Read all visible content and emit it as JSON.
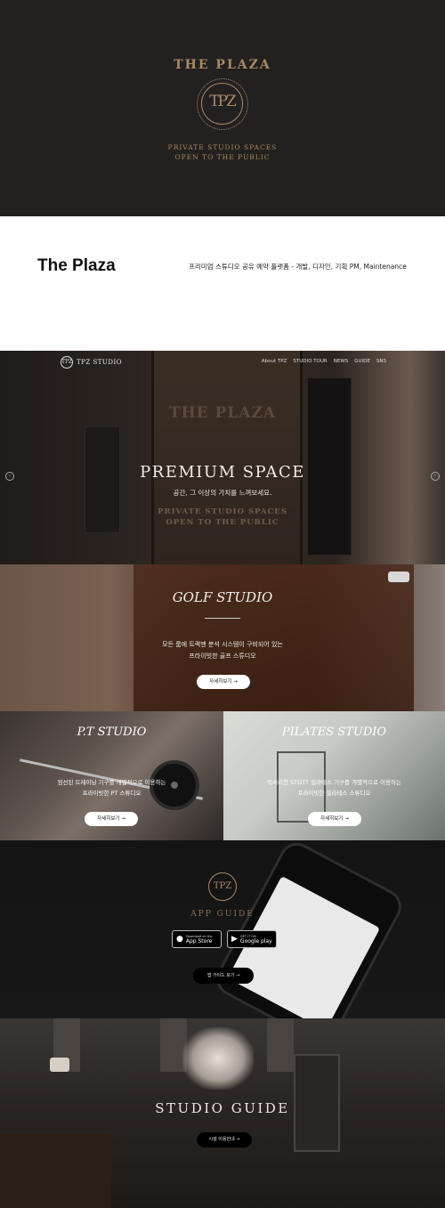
{
  "hero": {
    "title": "THE PLAZA",
    "seal": "TPZ",
    "sub1": "PRIVATE STUDIO SPACES",
    "sub2": "OPEN TO THE PUBLIC"
  },
  "intro": {
    "name": "The Plaza",
    "description": "프리미엄 스튜디오 공유 예약 플랫폼 - 개발, 디자인, 기획 PM, Maintenance"
  },
  "nav": {
    "logo_seal": "TPZ",
    "logo_text": "TPZ STUDIO",
    "menu": [
      "About TPZ",
      "STUDIO TOUR",
      "NEWS",
      "GUIDE",
      "SNS"
    ]
  },
  "premium": {
    "door_sign": "THE PLAZA",
    "title": "PREMIUM SPACE",
    "subtitle": "공간, 그 이상의 가치를 느껴보세요.",
    "en1": "PRIVATE STUDIO SPACES",
    "en2": "OPEN TO THE PUBLIC",
    "prev_icon": "‹",
    "next_icon": "›"
  },
  "golf": {
    "title": "GOLF STUDIO",
    "desc1": "모든 룸에 트랙맨 분석 시스템이 구비되어 있는",
    "desc2": "프라이빗한 골프 스튜디오",
    "button": "자세히보기 →"
  },
  "pt": {
    "title": "P.T STUDIO",
    "desc1": "엄선된 트레이닝 기구를 개별적으로 이용하는",
    "desc2": "프라이빗한 PT 스튜디오",
    "button": "자세히보기 →"
  },
  "pilates": {
    "title": "PILATES STUDIO",
    "desc1": "럭셔리한 STOTT 필라테스 기구를 개별적으로 이용하는",
    "desc2": "프라이빗한 필라테스 스튜디오",
    "button": "자세히보기 →"
  },
  "app": {
    "seal": "TPZ",
    "title": "APP GUIDE",
    "apple_small": "Download on the",
    "apple_big": "App Store",
    "google_small": "GET IT ON",
    "google_big": "Google play",
    "button": "앱 가이드 보기 →"
  },
  "guide": {
    "title": "STUDIO GUIDE",
    "button": "시설 이용안내 →"
  }
}
